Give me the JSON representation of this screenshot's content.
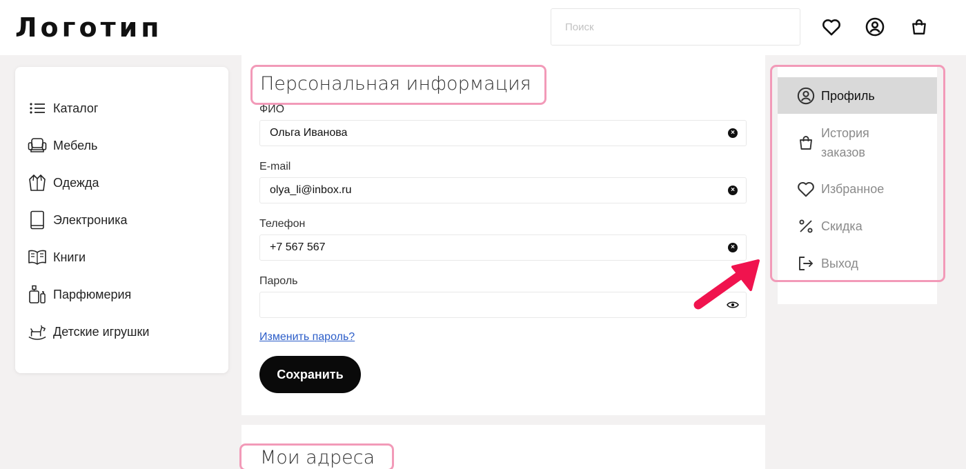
{
  "header": {
    "logo": "Логотип",
    "search_placeholder": "Поиск",
    "icons": [
      "heart-icon",
      "user-icon",
      "bag-icon"
    ]
  },
  "categories": [
    {
      "label": "Каталог",
      "icon": "list-icon"
    },
    {
      "label": "Мебель",
      "icon": "armchair-icon"
    },
    {
      "label": "Одежда",
      "icon": "jacket-icon"
    },
    {
      "label": "Электроника",
      "icon": "tablet-icon"
    },
    {
      "label": "Книги",
      "icon": "book-icon"
    },
    {
      "label": "Парфюмерия",
      "icon": "perfume-icon"
    },
    {
      "label": "Детские игрушки",
      "icon": "rocking-horse-icon"
    }
  ],
  "personal": {
    "title": "Персональная информация",
    "fields": [
      {
        "label": "ФИО",
        "value": "Ольга Иванова",
        "action": "clear-icon"
      },
      {
        "label": "E-mail",
        "value": "olya_li@inbox.ru",
        "action": "clear-icon"
      },
      {
        "label": "Телефон",
        "value": "+7 567 567",
        "action": "clear-icon"
      },
      {
        "label": "Пароль",
        "value": "",
        "action": "eye-icon"
      }
    ],
    "change_password": "Изменить пароль?",
    "save": "Сохранить"
  },
  "addresses": {
    "title": "Мои адреса"
  },
  "profile_menu": {
    "items": [
      {
        "label": "Профиль",
        "icon": "user-icon",
        "active": true
      },
      {
        "label": "История заказов",
        "icon": "bag-icon",
        "active": false
      },
      {
        "label": "Избранное",
        "icon": "heart-icon",
        "active": false
      },
      {
        "label": "Скидка",
        "icon": "percent-icon",
        "active": false
      },
      {
        "label": "Выход",
        "icon": "logout-icon",
        "active": false
      }
    ]
  },
  "colors": {
    "highlight": "#f29ab8",
    "arrow": "#f0134e",
    "active_menu_bg": "#d9d9d9",
    "link": "#2a5cc8",
    "button_bg": "#0a0a0a"
  }
}
